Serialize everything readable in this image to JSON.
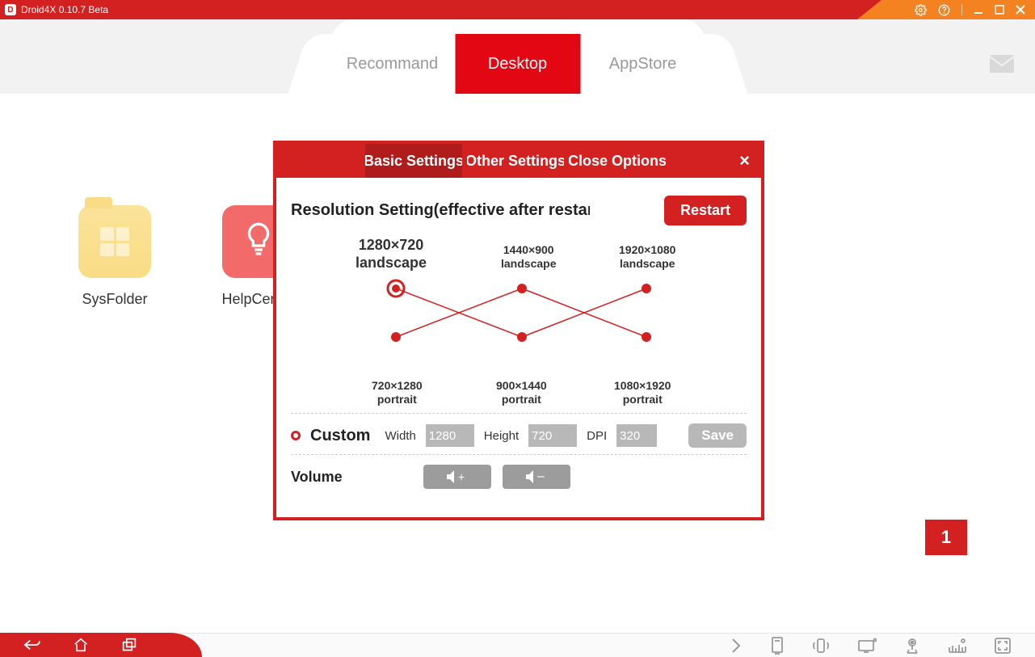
{
  "app": {
    "title": "Droid4X 0.10.7 Beta",
    "logo_letter": "D"
  },
  "tabs": {
    "recommand": "Recommand",
    "desktop": "Desktop",
    "appstore": "AppStore"
  },
  "desktop": {
    "icons": [
      {
        "name": "SysFolder"
      },
      {
        "name": "HelpCenter"
      }
    ]
  },
  "dialog": {
    "tabs": {
      "basic": "Basic Settings",
      "other": "Other Settings",
      "close": "Close Options"
    },
    "section_title": "Resolution Setting(effective after restart)",
    "restart": "Restart",
    "resolutions": {
      "landscape": [
        {
          "res": "1280×720",
          "orient": "landscape"
        },
        {
          "res": "1440×900",
          "orient": "landscape"
        },
        {
          "res": "1920×1080",
          "orient": "landscape"
        }
      ],
      "portrait": [
        {
          "res": "720×1280",
          "orient": "portrait"
        },
        {
          "res": "900×1440",
          "orient": "portrait"
        },
        {
          "res": "1080×1920",
          "orient": "portrait"
        }
      ]
    },
    "custom": {
      "label": "Custom",
      "width_label": "Width",
      "width_value": "1280",
      "height_label": "Height",
      "height_value": "720",
      "dpi_label": "DPI",
      "dpi_value": "320",
      "save": "Save"
    },
    "volume_label": "Volume"
  },
  "badge": "1"
}
